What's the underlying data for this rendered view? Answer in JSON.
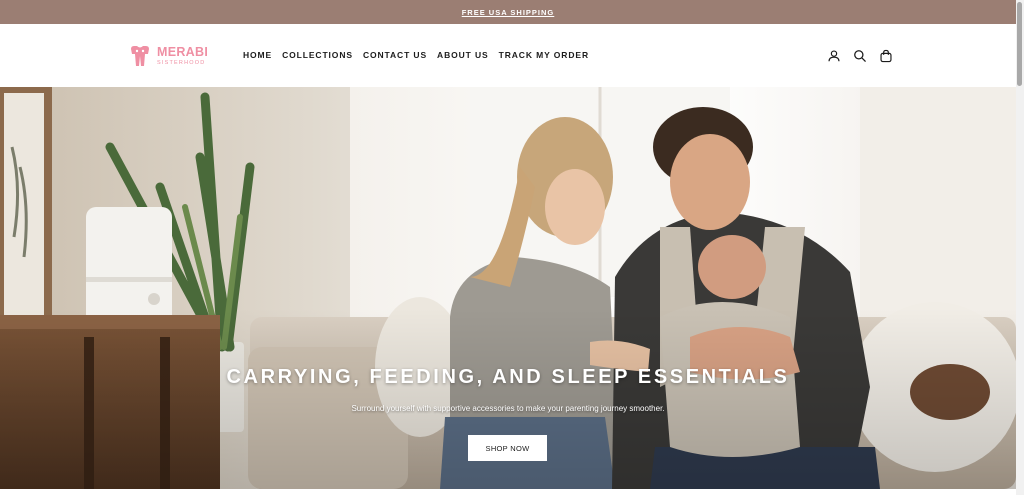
{
  "announcement": {
    "text": "FREE USA SHIPPING"
  },
  "brand": {
    "name": "MERABI",
    "tagline": "SISTERHOOD",
    "color": "#ef8fa3"
  },
  "nav": {
    "items": [
      {
        "label": "HOME"
      },
      {
        "label": "COLLECTIONS"
      },
      {
        "label": "CONTACT US"
      },
      {
        "label": "ABOUT US"
      },
      {
        "label": "TRACK MY ORDER"
      }
    ]
  },
  "header_icons": [
    "account-icon",
    "search-icon",
    "cart-bag-icon"
  ],
  "hero": {
    "title": "CARRYING, FEEDING, AND SLEEP ESSENTIALS",
    "subtitle": "Surround yourself with supportive accessories to make your parenting journey smoother.",
    "cta_label": "SHOP NOW"
  },
  "colors": {
    "announcement_bg": "#9b7e73",
    "text": "#1c1c1c"
  }
}
